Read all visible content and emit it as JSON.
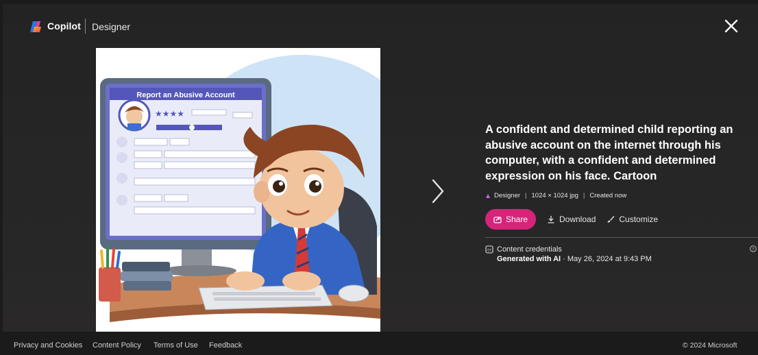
{
  "header": {
    "brand": "Copilot",
    "product": "Designer",
    "close_icon": "close-icon"
  },
  "image": {
    "screen_heading": "Report an Abusive Account",
    "subject": "cartoon-child-at-computer"
  },
  "details": {
    "prompt": "A confident and determined child reporting an abusive account on the internet through his computer, with a confident and determined expression on his face. Cartoon",
    "meta_source": "Designer",
    "meta_size": "1024 × 1024 jpg",
    "meta_created": "Created now",
    "share_label": "Share",
    "download_label": "Download",
    "customize_label": "Customize",
    "credentials_label": "Content credentials",
    "generated_label": "Generated with AI",
    "generated_date": "· May 26, 2024 at 9:43 PM"
  },
  "footer": {
    "links": [
      "Privacy and Cookies",
      "Content Policy",
      "Terms of Use",
      "Feedback"
    ],
    "copyright": "© 2024 Microsoft"
  },
  "colors": {
    "accent": "#d6247a",
    "background": "#1b1b1b"
  }
}
